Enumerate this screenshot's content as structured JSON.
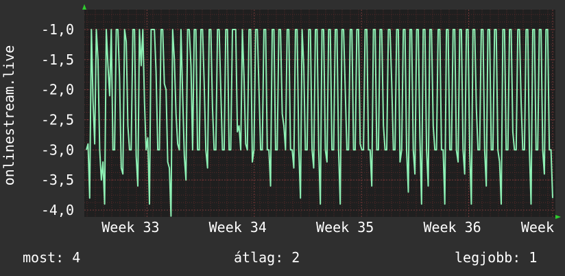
{
  "chart_data": {
    "type": "line",
    "title": "",
    "ylabel": "onlinestream.live",
    "xlabel": "",
    "ylim": [
      -4.0,
      -0.8
    ],
    "y_ticks": [
      -1.0,
      -1.5,
      -2.0,
      -2.5,
      -3.0,
      -3.5,
      -4.0
    ],
    "y_tick_labels": [
      "-1,0",
      "-1,5",
      "-2,0",
      "-2,5",
      "-3,0",
      "-3,5",
      "-4,0"
    ],
    "x_ticks": [
      {
        "label": "Week 33",
        "pos": 0.13
      },
      {
        "label": "Week 34",
        "pos": 0.36
      },
      {
        "label": "Week 35",
        "pos": 0.59
      },
      {
        "label": "Week 36",
        "pos": 0.82
      },
      {
        "label": "Week",
        "pos": 1.0
      }
    ],
    "grid": true,
    "series": [
      {
        "color": "#8ef0b4",
        "values": [
          -3.0,
          -2.9,
          -3.8,
          -1.0,
          -2.2,
          -2.9,
          -1.0,
          -1.5,
          -3.0,
          -3.5,
          -3.2,
          -3.9,
          -1.0,
          -1.6,
          -2.1,
          -1.0,
          -3.0,
          -3.0,
          -1.0,
          -1.0,
          -1.8,
          -3.3,
          -3.4,
          -1.0,
          -1.2,
          -2.6,
          -3.0,
          -3.0,
          -1.0,
          -1.0,
          -3.1,
          -3.6,
          -1.0,
          -1.6,
          -1.0,
          -2.2,
          -3.0,
          -2.8,
          -3.9,
          -1.0,
          -1.0,
          -1.0,
          -1.7,
          -3.0,
          -3.0,
          -1.0,
          -1.0,
          -1.9,
          -2.0,
          -3.2,
          -3.3,
          -4.1,
          -1.0,
          -1.5,
          -2.4,
          -2.9,
          -3.0,
          -1.0,
          -2.1,
          -3.1,
          -3.5,
          -1.0,
          -1.0,
          -1.6,
          -3.0,
          -1.0,
          -1.0,
          -3.0,
          -3.0,
          -1.0,
          -1.0,
          -1.9,
          -3.0,
          -3.3,
          -1.0,
          -1.0,
          -2.3,
          -3.0,
          -3.0,
          -1.0,
          -1.0,
          -2.0,
          -3.0,
          -3.0,
          -1.0,
          -1.0,
          -3.0,
          -3.0,
          -1.0,
          -1.0,
          -1.0,
          -2.7,
          -2.6,
          -3.0,
          -1.0,
          -1.8,
          -2.9,
          -3.0,
          -1.0,
          -1.0,
          -3.2,
          -3.0,
          -1.0,
          -1.0,
          -2.0,
          -3.0,
          -3.0,
          -1.0,
          -1.0,
          -3.0,
          -3.0,
          -3.6,
          -1.0,
          -1.0,
          -3.0,
          -3.0,
          -1.0,
          -1.0,
          -2.4,
          -2.6,
          -3.0,
          -1.0,
          -1.0,
          -3.0,
          -3.0,
          -3.3,
          -1.0,
          -1.0,
          -3.0,
          -3.8,
          -1.0,
          -1.6,
          -3.0,
          -3.0,
          -1.0,
          -1.0,
          -3.0,
          -3.3,
          -1.0,
          -1.0,
          -3.0,
          -3.9,
          -1.0,
          -1.0,
          -3.0,
          -3.2,
          -1.0,
          -1.0,
          -3.0,
          -3.0,
          -1.0,
          -1.0,
          -3.0,
          -3.9,
          -1.0,
          -1.0,
          -2.0,
          -3.0,
          -3.0,
          -1.0,
          -1.0,
          -3.0,
          -3.0,
          -1.0,
          -1.0,
          -2.9,
          -3.0,
          -3.0,
          -1.0,
          -1.0,
          -3.0,
          -3.0,
          -3.6,
          -1.0,
          -1.0,
          -3.0,
          -3.0,
          -1.0,
          -1.0,
          -2.6,
          -3.0,
          -3.0,
          -1.0,
          -1.0,
          -1.9,
          -3.0,
          -3.0,
          -1.0,
          -1.0,
          -3.2,
          -3.0,
          -1.0,
          -1.0,
          -3.0,
          -3.7,
          -1.0,
          -1.0,
          -3.0,
          -3.4,
          -1.0,
          -1.0,
          -2.8,
          -3.9,
          -1.0,
          -1.0,
          -3.0,
          -3.6,
          -1.0,
          -1.0,
          -2.6,
          -3.0,
          -3.0,
          -1.0,
          -1.0,
          -3.0,
          -3.0,
          -3.9,
          -1.0,
          -1.0,
          -3.0,
          -3.0,
          -1.0,
          -1.0,
          -3.0,
          -3.2,
          -1.0,
          -1.0,
          -3.0,
          -3.4,
          -1.0,
          -1.0,
          -3.0,
          -3.9,
          -1.0,
          -1.0,
          -2.3,
          -3.0,
          -3.0,
          -1.0,
          -1.0,
          -3.0,
          -3.6,
          -1.0,
          -1.0,
          -3.0,
          -3.0,
          -1.0,
          -1.0,
          -3.0,
          -3.2,
          -3.9,
          -1.0,
          -1.0,
          -3.0,
          -3.0,
          -1.0,
          -1.0,
          -2.7,
          -3.0,
          -3.0,
          -1.0,
          -1.0,
          -2.2,
          -3.0,
          -3.0,
          -1.0,
          -1.0,
          -3.0,
          -3.9,
          -1.0,
          -1.0,
          -3.0,
          -3.0,
          -1.0,
          -1.0,
          -3.0,
          -3.4,
          -1.0,
          -1.0,
          -3.0,
          -3.0,
          -3.8
        ]
      }
    ]
  },
  "summary": {
    "now": "most: 4",
    "avg": "átlag: 2",
    "max": "legjobb: 1"
  },
  "colors": {
    "background": "#2f2f2f",
    "plot_area": "#1f1f1f",
    "grid": "#5a2a2a",
    "line": "#8ef0b4",
    "axis_arrow": "#2fcc2f",
    "text": "#ffffff"
  }
}
